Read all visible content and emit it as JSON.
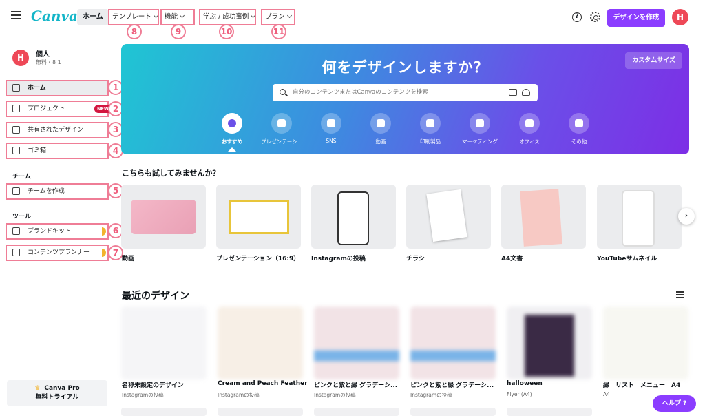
{
  "topbar": {
    "logo": "Canva",
    "home": "ホーム",
    "nav": [
      {
        "label": "テンプレート",
        "num": "8"
      },
      {
        "label": "機能",
        "num": "9"
      },
      {
        "label": "学ぶ / 成功事例",
        "num": "10"
      },
      {
        "label": "プラン",
        "num": "11"
      }
    ],
    "help_glyph": "?",
    "create_label": "デザインを作成",
    "avatar_initial": "H"
  },
  "sidebar": {
    "avatar_initial": "H",
    "user_name": "個人",
    "user_sub": "無料・8 1",
    "items": [
      {
        "label": "ホーム",
        "num": "1"
      },
      {
        "label": "プロジェクト",
        "num": "2",
        "badge": "NEW"
      },
      {
        "label": "共有されたデザイン",
        "num": "3"
      },
      {
        "label": "ゴミ箱",
        "num": "4"
      }
    ],
    "team_heading": "チーム",
    "team_items": [
      {
        "label": "チームを作成",
        "num": "5"
      }
    ],
    "tools_heading": "ツール",
    "tool_items": [
      {
        "label": "ブランドキット",
        "num": "6"
      },
      {
        "label": "コンテンツプランナー",
        "num": "7"
      }
    ],
    "pro_line1": "Canva Pro",
    "pro_line2": "無料トライアル",
    "crown": "♛"
  },
  "hero": {
    "title": "何をデザインしますか？",
    "custom_size": "カスタムサイズ",
    "search_placeholder": "自分のコンテンツまたはCanvaのコンテンツを検索",
    "categories": [
      "おすすめ",
      "プレゼンテーシ...",
      "SNS",
      "動画",
      "印刷製品",
      "マーケティング",
      "オフィス",
      "その他"
    ]
  },
  "try_section": {
    "title": "こちらも試してみませんか？",
    "cards": [
      "動画",
      "プレゼンテーション（16:9）",
      "Instagramの投稿",
      "チラシ",
      "A4文書",
      "YouTubeサムネイル"
    ],
    "next": "›"
  },
  "recent_section": {
    "title": "最近のデザイン",
    "items": [
      {
        "name": "名称未設定のデザイン",
        "sub": "Instagramの投稿"
      },
      {
        "name": "Cream and Peach Feather ...",
        "sub": "Instagramの投稿"
      },
      {
        "name": "ピンクと紫と緑 グラデーシ...",
        "sub": "Instagramの投稿"
      },
      {
        "name": "ピンクと紫と緑 グラデーシ...",
        "sub": "Instagramの投稿"
      },
      {
        "name": "halloween",
        "sub": "Flyer (A4)"
      },
      {
        "name": "緑　リスト　メニュー　A4",
        "sub": "A4"
      }
    ]
  },
  "help_button": "ヘルプ ?",
  "colors": {
    "accent": "#8b3dff",
    "annotation": "#ef7d96",
    "avatar": "#ee4857"
  }
}
